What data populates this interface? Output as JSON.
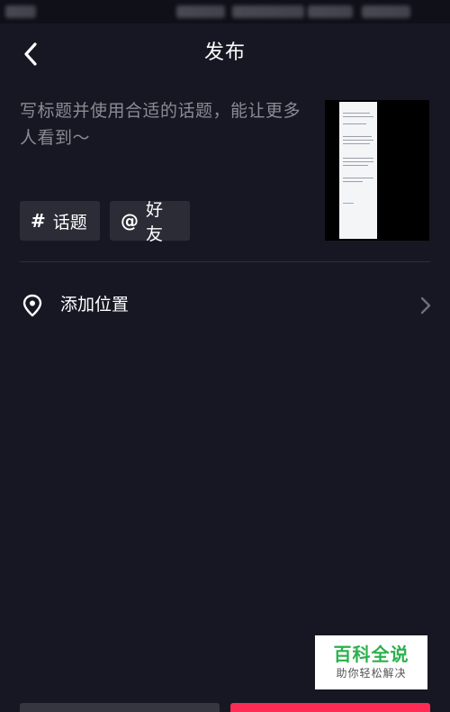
{
  "header": {
    "title": "发布"
  },
  "caption": {
    "placeholder": "写标题并使用合适的话题，能让更多人看到～"
  },
  "chips": [
    {
      "icon": "#",
      "label": "话题"
    },
    {
      "icon": "@",
      "label": "好友"
    }
  ],
  "location": {
    "label": "添加位置"
  },
  "watermark": {
    "title": "百科全说",
    "subtitle": "助你轻松解决"
  },
  "colors": {
    "background": "#161722",
    "chip": "#2b2c36",
    "publish": "#fe2c55",
    "placeholder": "#8a8b93"
  }
}
